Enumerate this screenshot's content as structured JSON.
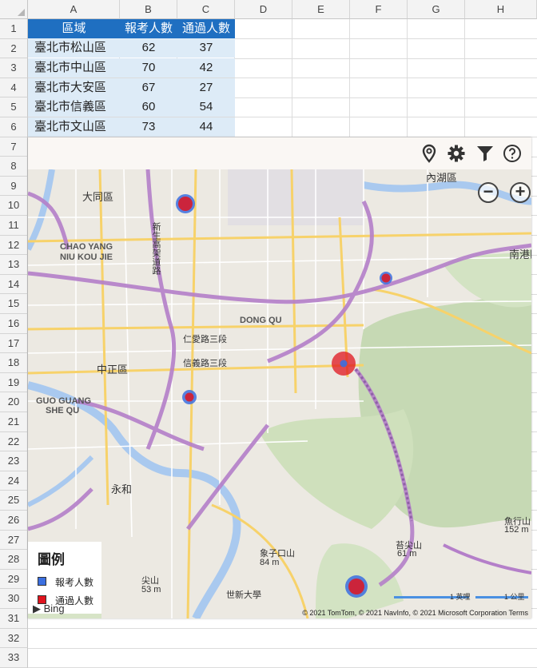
{
  "columns": [
    "A",
    "B",
    "C",
    "D",
    "E",
    "F",
    "G",
    "H"
  ],
  "rows": [
    "1",
    "2",
    "3",
    "4",
    "5",
    "6",
    "7",
    "8",
    "9",
    "10",
    "11",
    "12",
    "13",
    "14",
    "15",
    "16",
    "17",
    "18",
    "19",
    "20",
    "21",
    "22",
    "23",
    "24",
    "25",
    "26",
    "27",
    "28",
    "29",
    "30",
    "31",
    "32",
    "33"
  ],
  "table": {
    "headers": [
      "區域",
      "報考人數",
      "通過人數"
    ],
    "rows": [
      [
        "臺北市松山區",
        "62",
        "37"
      ],
      [
        "臺北市中山區",
        "70",
        "42"
      ],
      [
        "臺北市大安區",
        "67",
        "27"
      ],
      [
        "臺北市信義區",
        "60",
        "54"
      ],
      [
        "臺北市文山區",
        "73",
        "44"
      ]
    ]
  },
  "map": {
    "toolbar_icons": [
      "location-pin-icon",
      "gear-icon",
      "filter-icon",
      "help-icon"
    ],
    "zoom_out": "−",
    "zoom_in": "+",
    "labels": {
      "neihu": "內湖區",
      "datong": "大同區",
      "chaoyang": "CHAO YANG",
      "niuku": "NIU KOU JIE",
      "nangang": "南港區",
      "dongqu": "DONG QU",
      "zhongzheng": "中正區",
      "guoguang": "GUO GUANG",
      "shequ": "SHE QU",
      "yonghe": "永和",
      "xiangzi": "象子口山",
      "xiangzi_elev": "84 m",
      "jianshan": "尖山",
      "jianshan_elev": "53 m",
      "shixin": "世新大學",
      "yujian": "苔尖山",
      "yujian_elev": "61 m",
      "yuxing": "魚行山",
      "yuxing_elev": "152 m",
      "ren_ai": "仁愛路三段",
      "xinyi": "信義路三段",
      "xinsheng": "新生高架道路"
    },
    "legend": {
      "title": "圖例",
      "items": [
        {
          "label": "報考人數",
          "color": "#3b6fe0"
        },
        {
          "label": "通過人數",
          "color": "#e0141e"
        }
      ]
    },
    "scale": {
      "miles": "1 英哩",
      "km": "1 公里"
    },
    "attribution": "Bing",
    "copyright": "© 2021 TomTom, © 2021 NavInfo, © 2021 Microsoft Corporation  Terms"
  }
}
